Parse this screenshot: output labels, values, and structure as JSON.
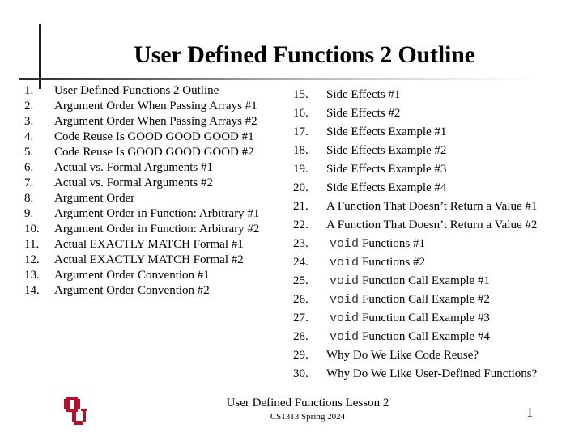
{
  "slide": {
    "title": "User Defined Functions 2 Outline",
    "accent_color": "#B0102C"
  },
  "outline": {
    "left": [
      {
        "num": "1.",
        "text": "User Defined Functions 2 Outline"
      },
      {
        "num": "2.",
        "text": "Argument Order When Passing Arrays #1"
      },
      {
        "num": "3.",
        "text": "Argument Order When Passing Arrays #2"
      },
      {
        "num": "4.",
        "text": "Code Reuse Is GOOD GOOD GOOD #1"
      },
      {
        "num": "5.",
        "text": "Code Reuse Is GOOD GOOD GOOD #2"
      },
      {
        "num": "6.",
        "text": "Actual vs. Formal Arguments #1"
      },
      {
        "num": "7.",
        "text": "Actual vs. Formal Arguments #2"
      },
      {
        "num": "8.",
        "text": "Argument Order"
      },
      {
        "num": "9.",
        "text": "Argument Order in Function: Arbitrary #1"
      },
      {
        "num": "10.",
        "text": "Argument Order in Function: Arbitrary #2"
      },
      {
        "num": "11.",
        "text": "Actual EXACTLY MATCH Formal #1"
      },
      {
        "num": "12.",
        "text": "Actual EXACTLY MATCH Formal #2"
      },
      {
        "num": "13.",
        "text": "Argument Order Convention #1"
      },
      {
        "num": "14.",
        "text": "Argument Order Convention #2"
      }
    ],
    "right": [
      {
        "num": "15.",
        "code": "",
        "text": "Side Effects #1"
      },
      {
        "num": "16.",
        "code": "",
        "text": "Side Effects #2"
      },
      {
        "num": "17.",
        "code": "",
        "text": "Side Effects Example #1"
      },
      {
        "num": "18.",
        "code": "",
        "text": "Side Effects Example #2"
      },
      {
        "num": "19.",
        "code": "",
        "text": "Side Effects Example #3"
      },
      {
        "num": "20.",
        "code": "",
        "text": "Side Effects Example #4"
      },
      {
        "num": "21.",
        "code": "",
        "text": "A Function That Doesn’t Return a Value #1"
      },
      {
        "num": "22.",
        "code": "",
        "text": "A Function That Doesn’t Return a Value #2"
      },
      {
        "num": "23.",
        "code": "void",
        "text": "Functions #1"
      },
      {
        "num": "24.",
        "code": "void",
        "text": "Functions #2"
      },
      {
        "num": "25.",
        "code": "void",
        "text": "Function Call Example #1"
      },
      {
        "num": "26.",
        "code": "void",
        "text": "Function Call Example #2"
      },
      {
        "num": "27.",
        "code": "void",
        "text": "Function Call Example #3"
      },
      {
        "num": "28.",
        "code": "void",
        "text": "Function Call Example #4"
      },
      {
        "num": "29.",
        "code": "",
        "text": "Why Do We Like Code Reuse?"
      },
      {
        "num": "30.",
        "code": "",
        "text": "Why Do We Like User-Defined Functions?"
      }
    ]
  },
  "footer": {
    "logo_icon": "ou-logo-icon",
    "lesson": "User Defined Functions Lesson 2",
    "course": "CS1313 Spring 2024",
    "page_number": "1"
  }
}
